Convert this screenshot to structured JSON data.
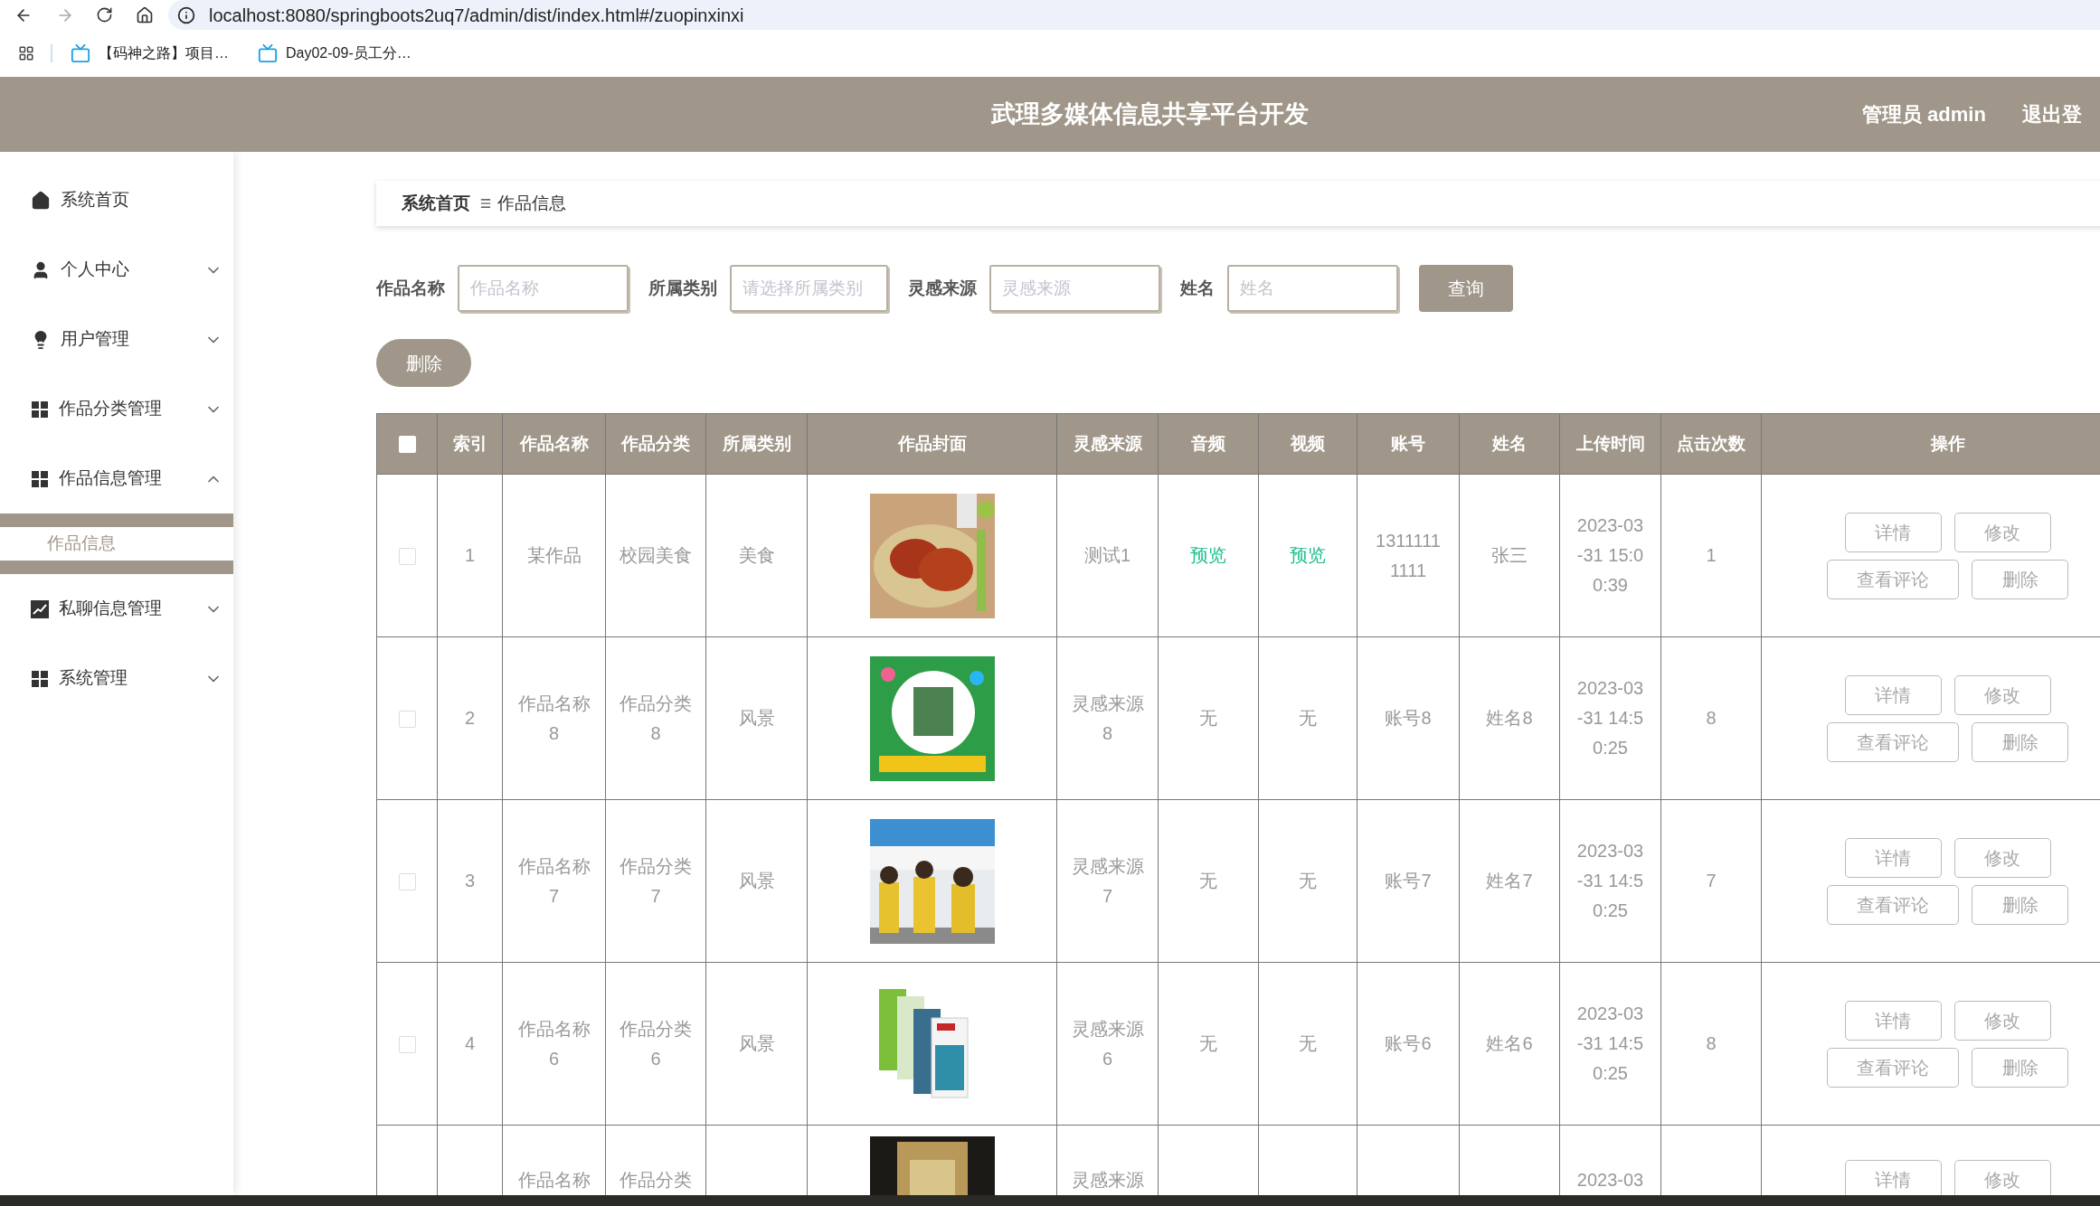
{
  "browser": {
    "url": "localhost:8080/springboots2uq7/admin/dist/index.html#/zuopinxinxi",
    "bookmarks": [
      "【码神之路】项目…",
      "Day02-09-员工分…"
    ]
  },
  "header": {
    "title": "武理多媒体信息共享平台开发",
    "user": "管理员 admin",
    "logout": "退出登"
  },
  "sidebar": {
    "items": [
      {
        "label": "系统首页",
        "kind": "link"
      },
      {
        "label": "个人中心",
        "kind": "menu",
        "expanded": false
      },
      {
        "label": "用户管理",
        "kind": "menu",
        "expanded": false
      },
      {
        "label": "作品分类管理",
        "kind": "menu",
        "expanded": false
      },
      {
        "label": "作品信息管理",
        "kind": "menu",
        "expanded": true,
        "children": [
          {
            "label": "作品信息",
            "selected": true
          }
        ]
      },
      {
        "label": "私聊信息管理",
        "kind": "menu",
        "expanded": false
      },
      {
        "label": "系统管理",
        "kind": "menu",
        "expanded": false
      }
    ]
  },
  "breadcrumb": [
    "系统首页",
    "作品信息"
  ],
  "search": {
    "fields": [
      {
        "label": "作品名称",
        "placeholder": "作品名称"
      },
      {
        "label": "所属类别",
        "placeholder": "请选择所属类别"
      },
      {
        "label": "灵感来源",
        "placeholder": "灵感来源"
      },
      {
        "label": "姓名",
        "placeholder": "姓名"
      }
    ],
    "button": "查询"
  },
  "delete_button": "删除",
  "table": {
    "header_checkbox": {
      "checked": false
    },
    "columns": [
      "索引",
      "作品名称",
      "作品分类",
      "所属类别",
      "作品封面",
      "灵感来源",
      "音频",
      "视频",
      "账号",
      "姓名",
      "上传时间",
      "点击次数",
      "操作"
    ],
    "rows": [
      {
        "kind": "full",
        "checked": false,
        "index": "1",
        "name": "某作品",
        "category": "校园美食",
        "type": "美食",
        "cover": {
          "kind": "picture"
        },
        "inspiration": "测试1",
        "audio": {
          "kind": "link",
          "text": "预览"
        },
        "video": {
          "kind": "link",
          "text": "预览"
        },
        "account": "13111111111",
        "username": "张三",
        "upload_time": "2023-03-31 15:00:39",
        "clicks": "1",
        "actions": [
          "详情",
          "修改",
          "查看评论",
          "删除"
        ]
      },
      {
        "kind": "full",
        "checked": false,
        "index": "2",
        "name": "作品名称8",
        "category": "作品分类8",
        "type": "风景",
        "cover": {
          "kind": "picture"
        },
        "inspiration": "灵感来源8",
        "audio": {
          "kind": "none",
          "text": "无"
        },
        "video": {
          "kind": "none",
          "text": "无"
        },
        "account": "账号8",
        "username": "姓名8",
        "upload_time": "2023-03-31 14:50:25",
        "clicks": "8",
        "actions": [
          "详情",
          "修改",
          "查看评论",
          "删除"
        ]
      },
      {
        "kind": "full",
        "checked": false,
        "index": "3",
        "name": "作品名称7",
        "category": "作品分类7",
        "type": "风景",
        "cover": {
          "kind": "picture"
        },
        "inspiration": "灵感来源7",
        "audio": {
          "kind": "none",
          "text": "无"
        },
        "video": {
          "kind": "none",
          "text": "无"
        },
        "account": "账号7",
        "username": "姓名7",
        "upload_time": "2023-03-31 14:50:25",
        "clicks": "7",
        "actions": [
          "详情",
          "修改",
          "查看评论",
          "删除"
        ]
      },
      {
        "kind": "full",
        "checked": false,
        "index": "4",
        "name": "作品名称6",
        "category": "作品分类6",
        "type": "风景",
        "cover": {
          "kind": "picture"
        },
        "inspiration": "灵感来源6",
        "audio": {
          "kind": "none",
          "text": "无"
        },
        "video": {
          "kind": "none",
          "text": "无"
        },
        "account": "账号6",
        "username": "姓名6",
        "upload_time": "2023-03-31 14:50:25",
        "clicks": "8",
        "actions": [
          "详情",
          "修改",
          "查看评论",
          "删除"
        ]
      },
      {
        "kind": "cut",
        "name": "作品名称",
        "category": "作品分类",
        "cover": {
          "kind": "picture"
        },
        "inspiration": "灵感来源",
        "upload_time": "2023-03",
        "actions": [
          "详情",
          "修改"
        ]
      }
    ]
  }
}
